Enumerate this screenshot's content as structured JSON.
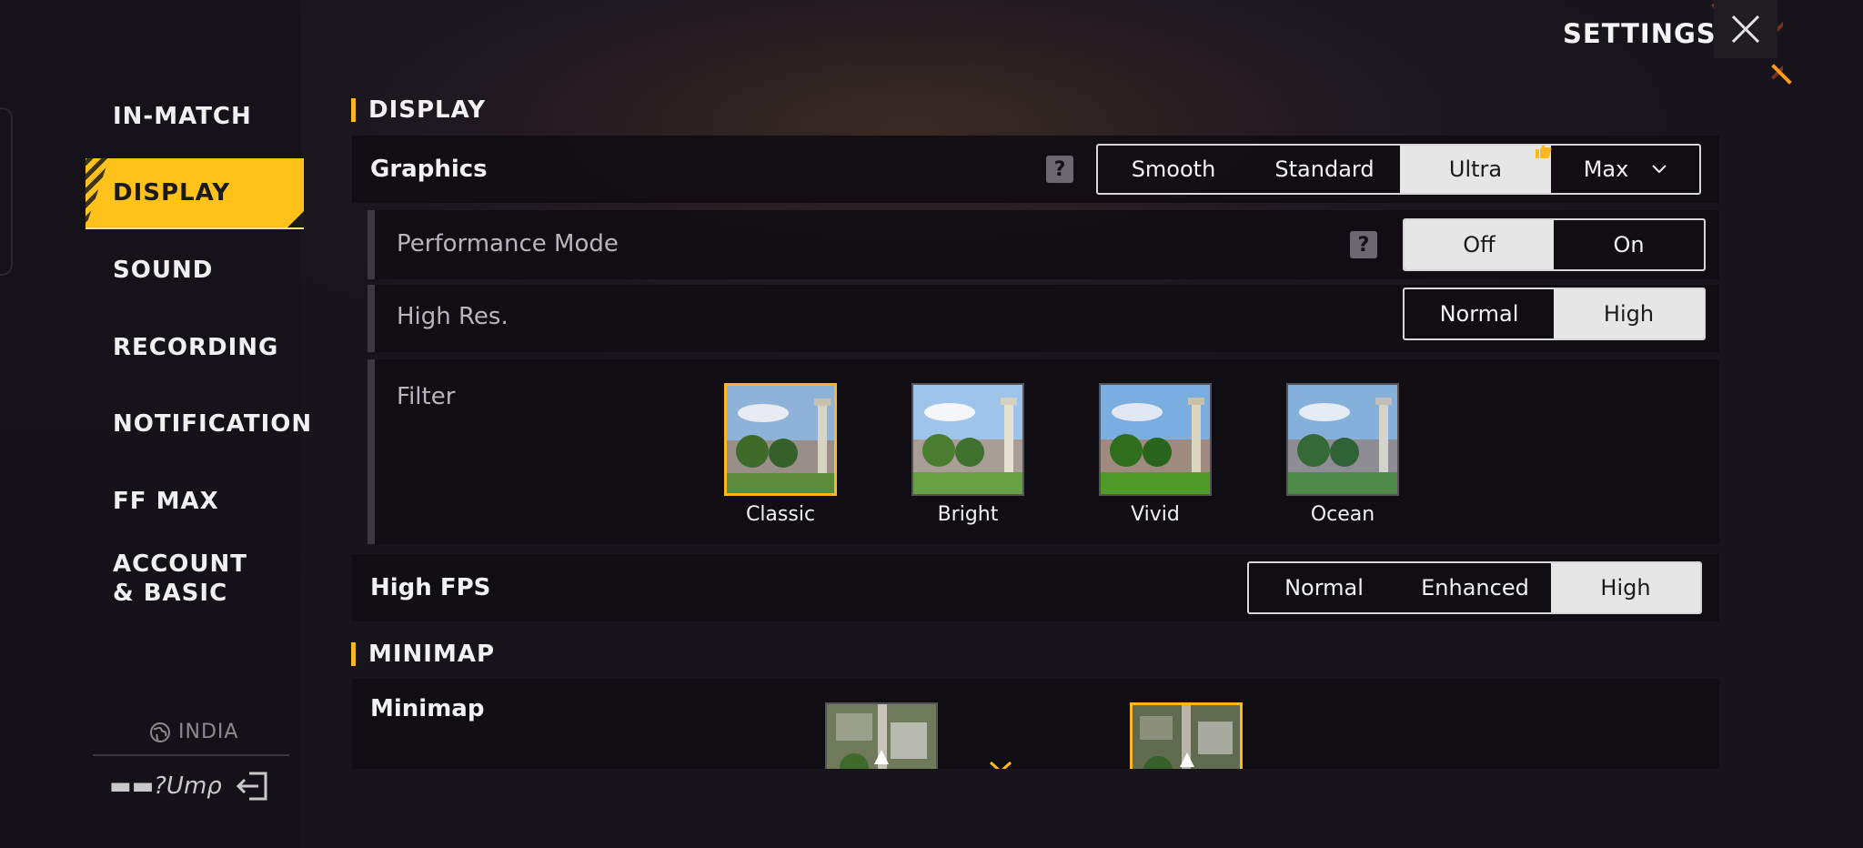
{
  "sidebar": {
    "items": [
      {
        "label": "IN-MATCH"
      },
      {
        "label": "DISPLAY"
      },
      {
        "label": "SOUND"
      },
      {
        "label": "RECORDING"
      },
      {
        "label": "NOTIFICATION"
      },
      {
        "label": "FF MAX"
      },
      {
        "label": "ACCOUNT & BASIC"
      }
    ],
    "region": "INDIA",
    "user_name": "▬▬?Umρ"
  },
  "header": {
    "title": "SETTINGS"
  },
  "display": {
    "section_title": "DISPLAY",
    "graphics": {
      "label": "Graphics",
      "options": [
        "Smooth",
        "Standard",
        "Ultra",
        "Max"
      ],
      "selected": "Ultra"
    },
    "performance_mode": {
      "label": "Performance Mode",
      "options": [
        "Off",
        "On"
      ],
      "selected": "Off"
    },
    "high_res": {
      "label": "High Res.",
      "options": [
        "Normal",
        "High"
      ],
      "selected": "High"
    },
    "filter": {
      "label": "Filter",
      "options": [
        "Classic",
        "Bright",
        "Vivid",
        "Ocean"
      ],
      "selected": "Classic"
    },
    "high_fps": {
      "label": "High FPS",
      "options": [
        "Normal",
        "Enhanced",
        "High"
      ],
      "selected": "High"
    }
  },
  "minimap": {
    "section_title": "MINIMAP",
    "label": "Minimap",
    "selected_index": 1
  },
  "icons": {
    "help": "?",
    "close": "close-icon",
    "globe": "globe-icon",
    "exit": "exit-icon",
    "thumb": "thumbs-up-icon"
  }
}
